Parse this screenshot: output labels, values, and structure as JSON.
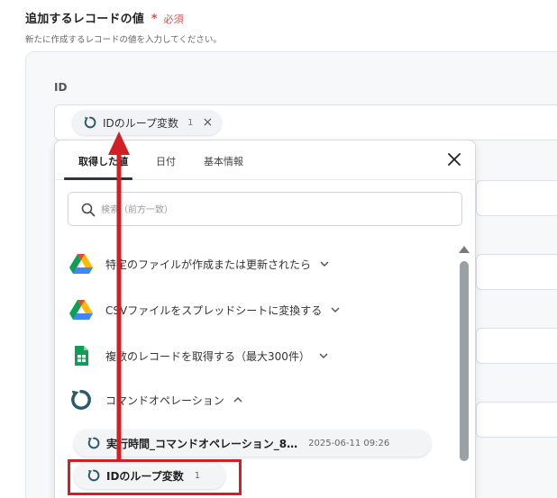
{
  "section": {
    "title": "追加するレコードの値",
    "required_star": "*",
    "required_text": "必須",
    "description": "新たに作成するレコードの値を入力してください。"
  },
  "field": {
    "label": "ID",
    "chip": {
      "label": "IDのループ変数",
      "count": "1",
      "remove_glyph": "×"
    }
  },
  "dropdown": {
    "tabs": [
      {
        "label": "取得した値",
        "active": true
      },
      {
        "label": "日付",
        "active": false
      },
      {
        "label": "基本情報",
        "active": false
      }
    ],
    "search_placeholder": "検索（前方一致）",
    "steps": [
      {
        "label": "特定のファイルが作成または更新されたら",
        "icon": "google-drive-icon",
        "expanded": false
      },
      {
        "label": "CSVファイルをスプレッドシートに変換する",
        "icon": "google-drive-icon",
        "expanded": false
      },
      {
        "label": "複数のレコードを取得する（最大300件）",
        "icon": "google-sheets-icon",
        "expanded": false
      },
      {
        "label": "コマンドオペレーション",
        "icon": "loop-icon",
        "expanded": true
      }
    ],
    "outputs": [
      {
        "label": "実行時間_コマンドオペレーション_8…",
        "timestamp": "2025-06-11 09:26"
      },
      {
        "label": "IDのループ変数",
        "count": "1"
      }
    ]
  },
  "colors": {
    "accent_dark": "#2e3440",
    "required_red": "#e05050",
    "annotation_red": "#d21f26",
    "loop_icon": "#2b5a6b"
  }
}
